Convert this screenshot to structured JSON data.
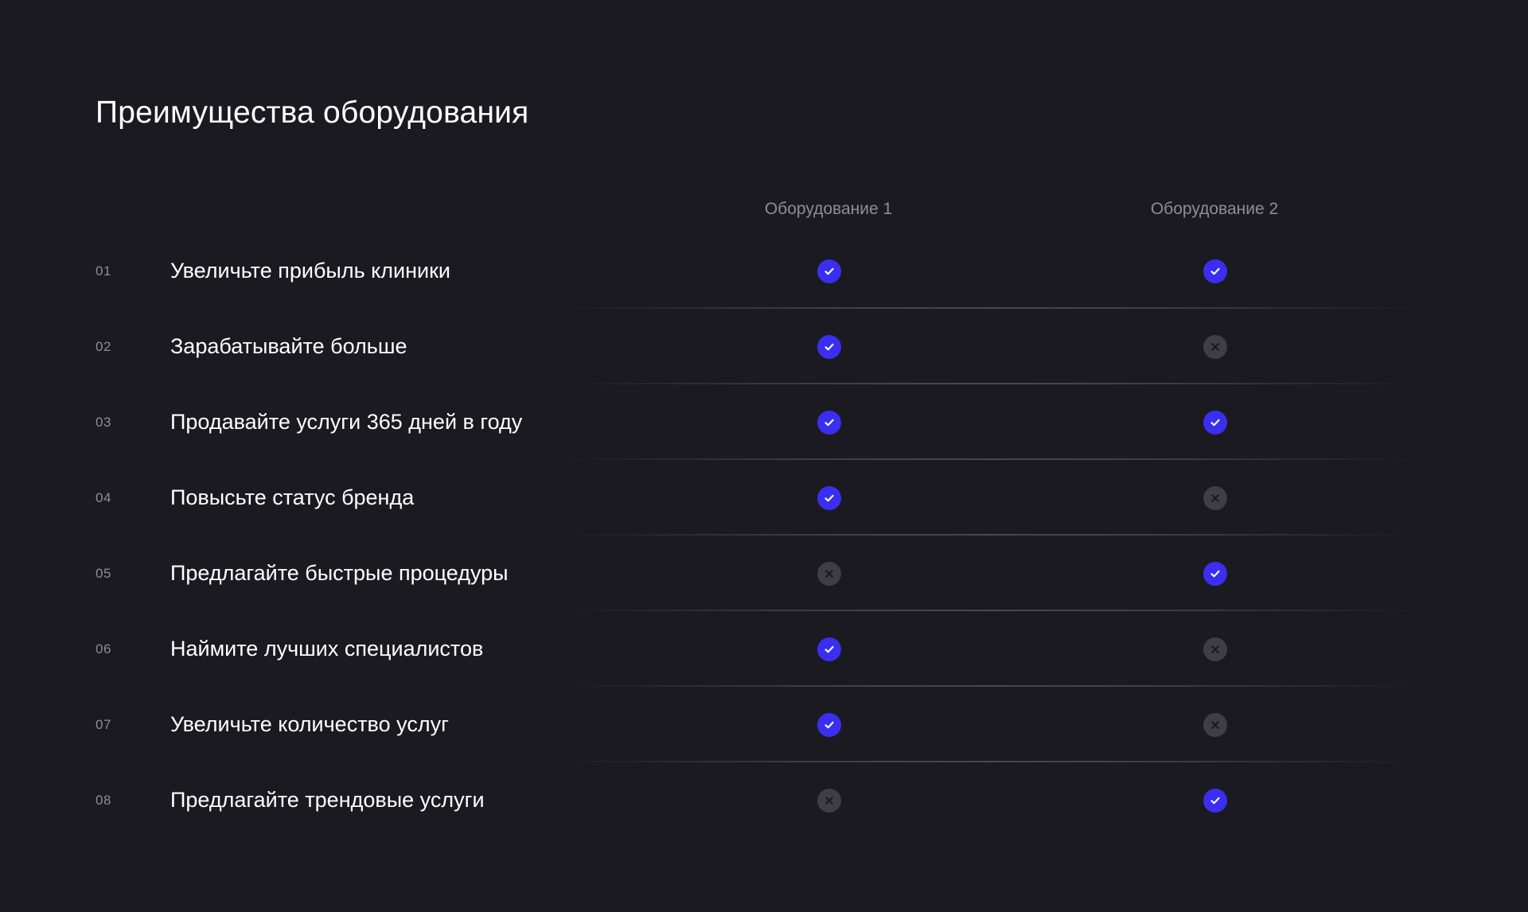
{
  "page": {
    "title": "Преимущества оборудования"
  },
  "table": {
    "columns": [
      "Оборудование 1",
      "Оборудование 2"
    ],
    "rows": [
      {
        "num": "01",
        "label": "Увеличьте прибыль клиники",
        "values": [
          true,
          true
        ]
      },
      {
        "num": "02",
        "label": "Зарабатывайте больше",
        "values": [
          true,
          false
        ]
      },
      {
        "num": "03",
        "label": "Продавайте услуги 365 дней в году",
        "values": [
          true,
          true
        ]
      },
      {
        "num": "04",
        "label": "Повысьте статус бренда",
        "values": [
          true,
          false
        ]
      },
      {
        "num": "05",
        "label": "Предлагайте быстрые процедуры",
        "values": [
          false,
          true
        ]
      },
      {
        "num": "06",
        "label": "Наймите лучших специалистов",
        "values": [
          true,
          false
        ]
      },
      {
        "num": "07",
        "label": "Увеличьте количество услуг",
        "values": [
          true,
          false
        ]
      },
      {
        "num": "08",
        "label": "Предлагайте трендовые услуги",
        "values": [
          false,
          true
        ]
      }
    ]
  },
  "icons": {
    "yes": "check-circle-icon",
    "no": "cross-circle-icon"
  },
  "colors": {
    "background": "#1b1a21",
    "accent": "#3a2ff0",
    "negative": "#3f3e45",
    "muted_text": "#8e8d95"
  }
}
